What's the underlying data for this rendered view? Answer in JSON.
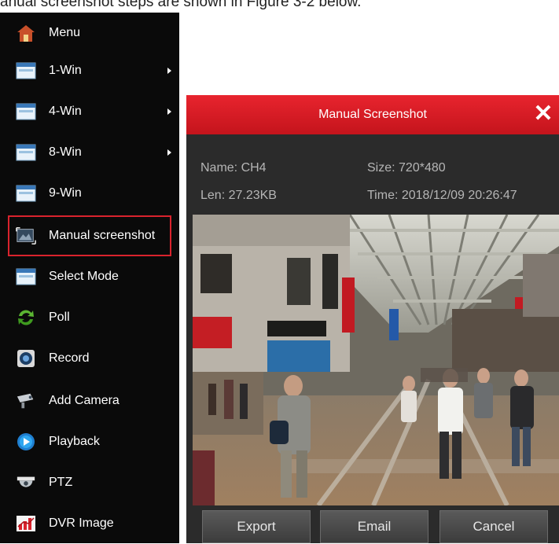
{
  "caption": "anual screenshot steps are shown in Figure 3-2 below.",
  "menu": {
    "items": [
      {
        "label": "Menu",
        "icon": "home-icon",
        "arrow": false
      },
      {
        "label": "1-Win",
        "icon": "window-icon",
        "arrow": true
      },
      {
        "label": "4-Win",
        "icon": "window-icon",
        "arrow": true
      },
      {
        "label": "8-Win",
        "icon": "window-icon",
        "arrow": true
      },
      {
        "label": "9-Win",
        "icon": "window-icon",
        "arrow": false
      },
      {
        "label": "Manual screenshot",
        "icon": "screenshot-icon",
        "arrow": false,
        "selected": true
      },
      {
        "label": "Select Mode",
        "icon": "window-icon",
        "arrow": false
      },
      {
        "label": "Poll",
        "icon": "refresh-icon",
        "arrow": false
      },
      {
        "label": "Record",
        "icon": "record-icon",
        "arrow": false
      },
      {
        "label": "Add Camera",
        "icon": "camera-icon",
        "arrow": false
      },
      {
        "label": "Playback",
        "icon": "playback-icon",
        "arrow": false
      },
      {
        "label": "PTZ",
        "icon": "dome-camera-icon",
        "arrow": false
      },
      {
        "label": "DVR Image",
        "icon": "chart-icon",
        "arrow": false
      }
    ]
  },
  "dialog": {
    "title": "Manual Screenshot",
    "name": "Name: CH4",
    "size": "Size: 720*480",
    "len": "Len: 27.23KB",
    "time": "Time: 2018/12/09 20:26:47",
    "buttons": {
      "export": "Export",
      "email": "Email",
      "cancel": "Cancel"
    },
    "colors": {
      "header": "#d61f27",
      "body": "#2b2b2b",
      "selection_outline": "#d9232d"
    }
  }
}
